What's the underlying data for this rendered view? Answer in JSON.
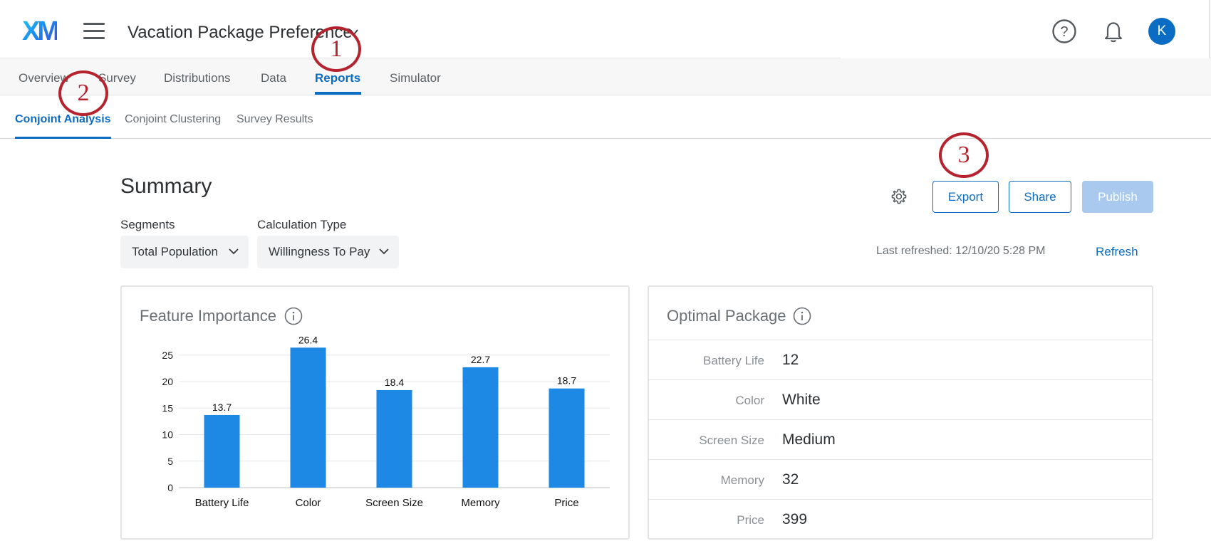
{
  "header": {
    "logo": "XM",
    "project_title": "Vacation Package Preference",
    "avatar_initial": "K"
  },
  "main_nav": {
    "tabs": [
      "Overview",
      "Survey",
      "Distributions",
      "Data",
      "Reports",
      "Simulator"
    ],
    "active": "Reports"
  },
  "sub_nav": {
    "tabs": [
      "Conjoint Analysis",
      "Conjoint Clustering",
      "Survey Results"
    ],
    "active": "Conjoint Analysis"
  },
  "summary": {
    "title": "Summary",
    "buttons": {
      "export": "Export",
      "share": "Share",
      "publish": "Publish"
    },
    "segments_label": "Segments",
    "segments_value": "Total Population",
    "calc_label": "Calculation Type",
    "calc_value": "Willingness To Pay",
    "last_refreshed": "Last refreshed: 12/10/20 5:28 PM",
    "refresh_link": "Refresh"
  },
  "feature_importance": {
    "title": "Feature Importance"
  },
  "chart_data": {
    "type": "bar",
    "categories": [
      "Battery Life",
      "Color",
      "Screen Size",
      "Memory",
      "Price"
    ],
    "values": [
      13.7,
      26.4,
      18.4,
      22.7,
      18.7
    ],
    "value_labels": [
      "13.7",
      "26.4",
      "18.4",
      "22.7",
      "18.7"
    ],
    "yticks": [
      "0",
      "5",
      "10",
      "15",
      "20",
      "25"
    ],
    "ylim": [
      0,
      25
    ],
    "grid": true,
    "bar_color": "#1e88e5"
  },
  "optimal_package": {
    "title": "Optimal Package",
    "rows": [
      {
        "label": "Battery Life",
        "value": "12"
      },
      {
        "label": "Color",
        "value": "White"
      },
      {
        "label": "Screen Size",
        "value": "Medium"
      },
      {
        "label": "Memory",
        "value": "32"
      },
      {
        "label": "Price",
        "value": "399"
      }
    ]
  },
  "callouts": [
    "1",
    "2",
    "3"
  ],
  "colors": {
    "accent": "#0b6cc4",
    "callout": "#b5232f",
    "publish_disabled": "#a9c9ee"
  },
  "icons": [
    "hamburger-icon",
    "chevron-down-icon",
    "help-icon",
    "bell-icon",
    "gear-icon",
    "info-icon"
  ]
}
